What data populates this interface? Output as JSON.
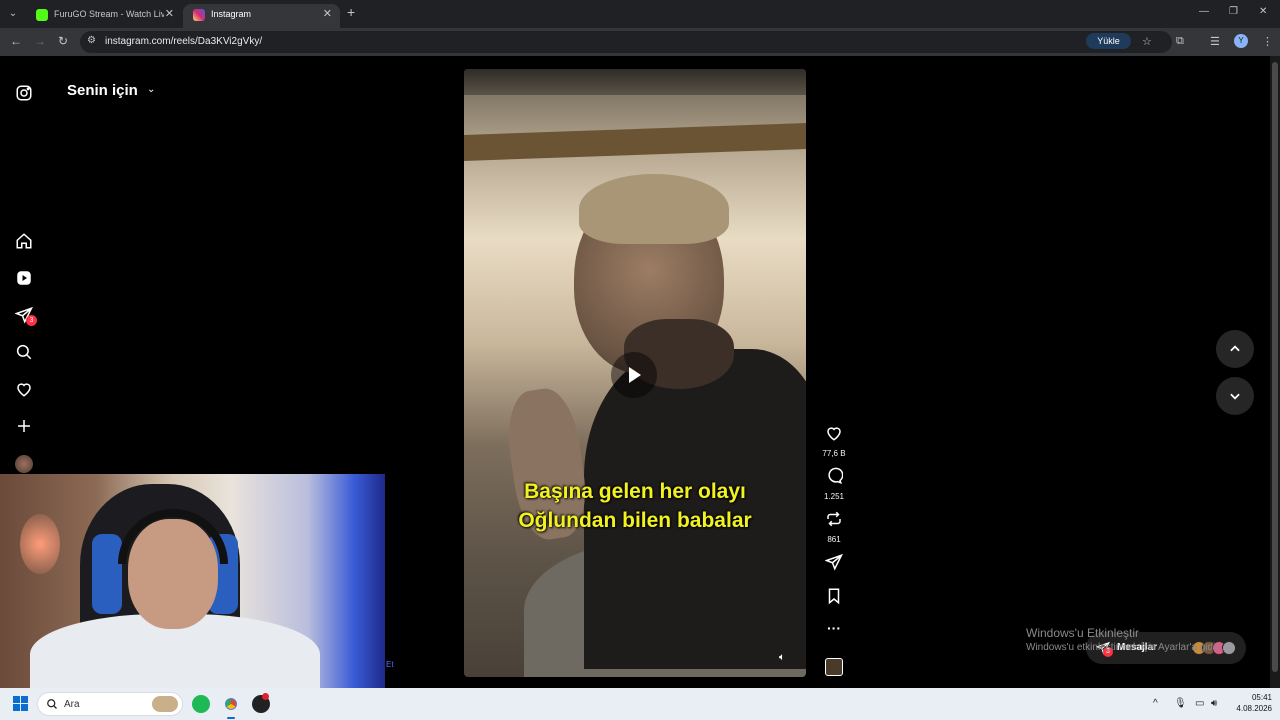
{
  "browser": {
    "tabs": [
      {
        "title": "FuruGO Stream - Watch Live o",
        "favicon_color": "#53fc18",
        "active": false
      },
      {
        "title": "Instagram",
        "favicon_color": "#e1306c",
        "active": true
      }
    ],
    "url": "instagram.com/reels/Da3KVi2gVky/",
    "upload_label": "Yükle",
    "profile_initial": "Y"
  },
  "instagram": {
    "feed_title": "Senin için",
    "nav_items": [
      {
        "name": "home",
        "icon": "home-icon"
      },
      {
        "name": "reels",
        "icon": "reels-icon"
      },
      {
        "name": "messages",
        "icon": "direct-icon",
        "badge": "3"
      },
      {
        "name": "search",
        "icon": "search-icon"
      },
      {
        "name": "notifications",
        "icon": "heart-icon"
      },
      {
        "name": "create",
        "icon": "plus-icon"
      },
      {
        "name": "profile",
        "icon": "avatar"
      }
    ],
    "reel": {
      "caption_line1": "Başına gelen her olayı",
      "caption_line2": "Oğlundan bilen babalar",
      "likes": "77,6 B",
      "comments": "1.251",
      "reposts": "861"
    },
    "messages_pill": {
      "label": "Mesajlar",
      "badge": "3"
    }
  },
  "windows": {
    "activation_title": "Windows'u Etkinleştir",
    "activation_sub": "Windows'u etkinleştirmek için Ayarlar'a gidin.",
    "search_placeholder": "Ara",
    "time": "05:41",
    "date": "4.08.2026"
  },
  "webcam_edge_text": "Et",
  "colors": {
    "accent": "#0095f6",
    "badge": "#ff3040",
    "caption": "#f1f21f"
  }
}
